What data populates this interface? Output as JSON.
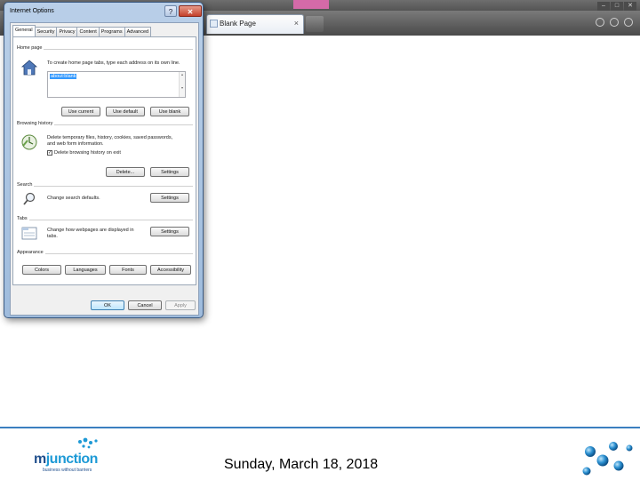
{
  "browser": {
    "tab_title": "Blank Page",
    "tab_close": "×",
    "window_controls": [
      "–",
      "□",
      "✕"
    ],
    "accent_tab_color": "#d46aa8"
  },
  "dialog": {
    "title": "Internet Options",
    "help": "?",
    "close": "✕",
    "tabs": [
      "General",
      "Security",
      "Privacy",
      "Content",
      "Programs",
      "Advanced"
    ],
    "home_page": {
      "label": "Home page",
      "description": "To create home page tabs, type each address on its own line.",
      "value": "about:blank",
      "buttons": [
        "Use current",
        "Use default",
        "Use blank"
      ]
    },
    "browsing_history": {
      "label": "Browsing history",
      "description_line1": "Delete temporary files, history, cookies, saved passwords,",
      "description_line2": "and web form information.",
      "checkbox_label": "Delete browsing history on exit",
      "checkbox_checked": true,
      "buttons": [
        "Delete...",
        "Settings"
      ]
    },
    "search": {
      "label": "Search",
      "description": "Change search defaults.",
      "button": "Settings"
    },
    "tabs_section": {
      "label": "Tabs",
      "description_line1": "Change how webpages are displayed in",
      "description_line2": "tabs.",
      "button": "Settings"
    },
    "appearance": {
      "label": "Appearance",
      "buttons": [
        "Colors",
        "Languages",
        "Fonts",
        "Accessibility"
      ]
    },
    "footer_buttons": [
      "OK",
      "Cancel",
      "Apply"
    ]
  },
  "footer": {
    "logo_text_a": "m",
    "logo_text_b": "junction",
    "logo_tagline": "business without barriers",
    "date": "Sunday, March 18, 2018",
    "brand_color": "#1f4e8c",
    "accent_color": "#1e9ad6"
  }
}
